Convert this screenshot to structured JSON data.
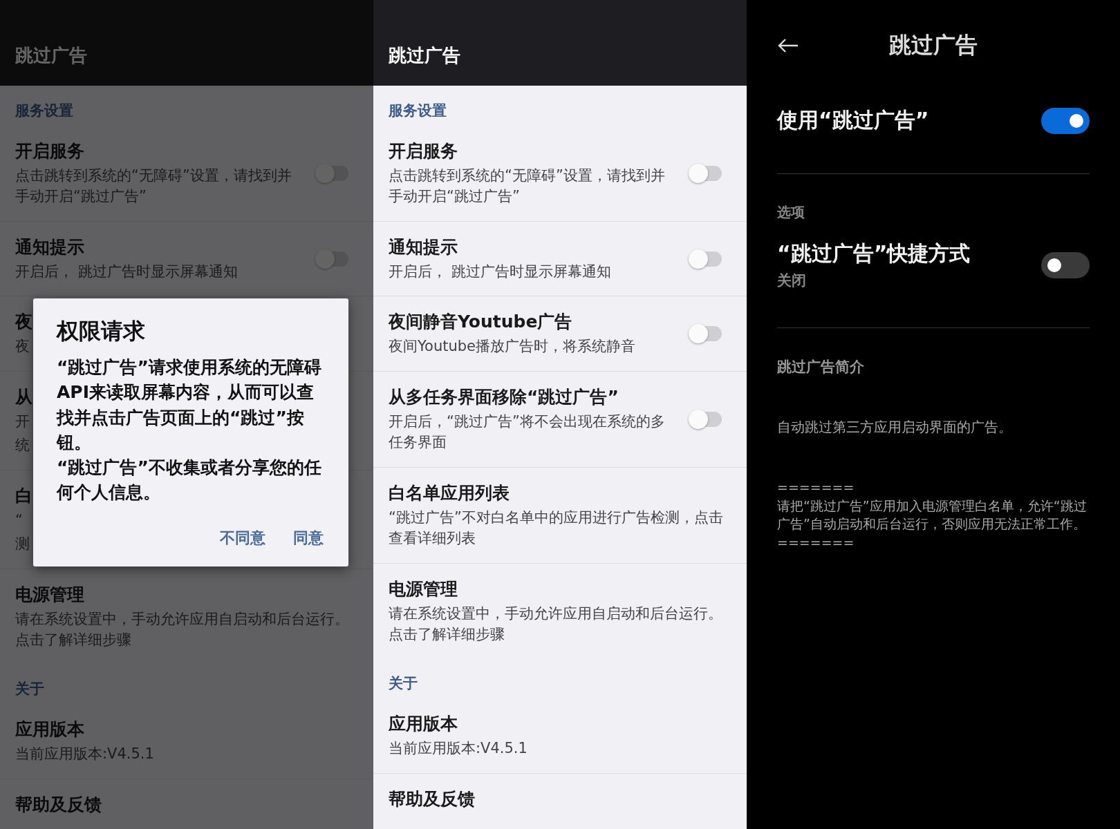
{
  "panels": [
    {
      "kind": "list",
      "dimmed": true,
      "title": "跳过广告",
      "sections": [
        {
          "label": "服务设置",
          "items": [
            {
              "kind": "switch",
              "title": "开启服务",
              "subtitle": "点击跳转到系统的“无障碍”设置，请找到并手动开启“跳过广告”",
              "on": false
            },
            {
              "kind": "switch",
              "title": "通知提示",
              "subtitle": "开启后， 跳过广告时显示屏幕通知",
              "on": false
            },
            {
              "kind": "text",
              "title": "夜",
              "subtitle": "夜"
            },
            {
              "kind": "text",
              "title": "从",
              "subtitle_lines": [
                "开",
                "统"
              ]
            },
            {
              "kind": "text",
              "title": "白",
              "subtitle_lines": [
                "“",
                "测"
              ]
            },
            {
              "kind": "text",
              "title": "电源管理",
              "subtitle": "请在系统设置中，手动允许应用自启动和后台运行。点击了解详细步骤"
            }
          ]
        },
        {
          "label": "关于",
          "items": [
            {
              "kind": "text",
              "title": "应用版本",
              "subtitle": "当前应用版本:V4.5.1"
            },
            {
              "kind": "text",
              "title": "帮助及反馈"
            }
          ]
        }
      ],
      "dialog": {
        "title": "权限请求",
        "body": "“跳过广告”请求使用系统的无障碍API来读取屏幕内容，从而可以查找并点击广告页面上的“跳过”按钮。\n“跳过广告”不收集或者分享您的任何个人信息。",
        "buttons": [
          "不同意",
          "同意"
        ]
      }
    },
    {
      "kind": "list",
      "dimmed": false,
      "title": "跳过广告",
      "sections": [
        {
          "label": "服务设置",
          "items": [
            {
              "kind": "switch",
              "title": "开启服务",
              "subtitle": "点击跳转到系统的“无障碍”设置，请找到并手动开启“跳过广告”",
              "on": false
            },
            {
              "kind": "switch",
              "title": "通知提示",
              "subtitle": "开启后， 跳过广告时显示屏幕通知",
              "on": false
            },
            {
              "kind": "switch",
              "title": "夜间静音Youtube广告",
              "subtitle": "夜间Youtube播放广告时，将系统静音",
              "on": false
            },
            {
              "kind": "switch",
              "title": "从多任务界面移除“跳过广告”",
              "subtitle": "开启后，“跳过广告”将不会出现在系统的多任务界面",
              "on": false
            },
            {
              "kind": "text",
              "title": "白名单应用列表",
              "subtitle": "“跳过广告”不对白名单中的应用进行广告检测，点击查看详细列表"
            },
            {
              "kind": "text",
              "title": "电源管理",
              "subtitle": "请在系统设置中，手动允许应用自启动和后台运行。点击了解详细步骤"
            }
          ]
        },
        {
          "label": "关于",
          "items": [
            {
              "kind": "text",
              "title": "应用版本",
              "subtitle": "当前应用版本:V4.5.1"
            },
            {
              "kind": "text",
              "title": "帮助及反馈"
            }
          ]
        }
      ]
    },
    {
      "kind": "detail",
      "title": "跳过广告",
      "main_switch": {
        "label": "使用“跳过广告”",
        "on": true
      },
      "section_label": "选项",
      "options": [
        {
          "title": "“跳过广告”快捷方式",
          "subtitle": "关闭",
          "on": false
        }
      ],
      "about": {
        "heading": "跳过广告简介",
        "intro": "自动跳过第三方应用启动界面的广告。",
        "notes": [
          "=======",
          "请把“跳过广告”应用加入电源管理白名单，允许“跳过广告”自动启动和后台运行，否则应用无法正常工作。",
          "======="
        ]
      }
    }
  ]
}
